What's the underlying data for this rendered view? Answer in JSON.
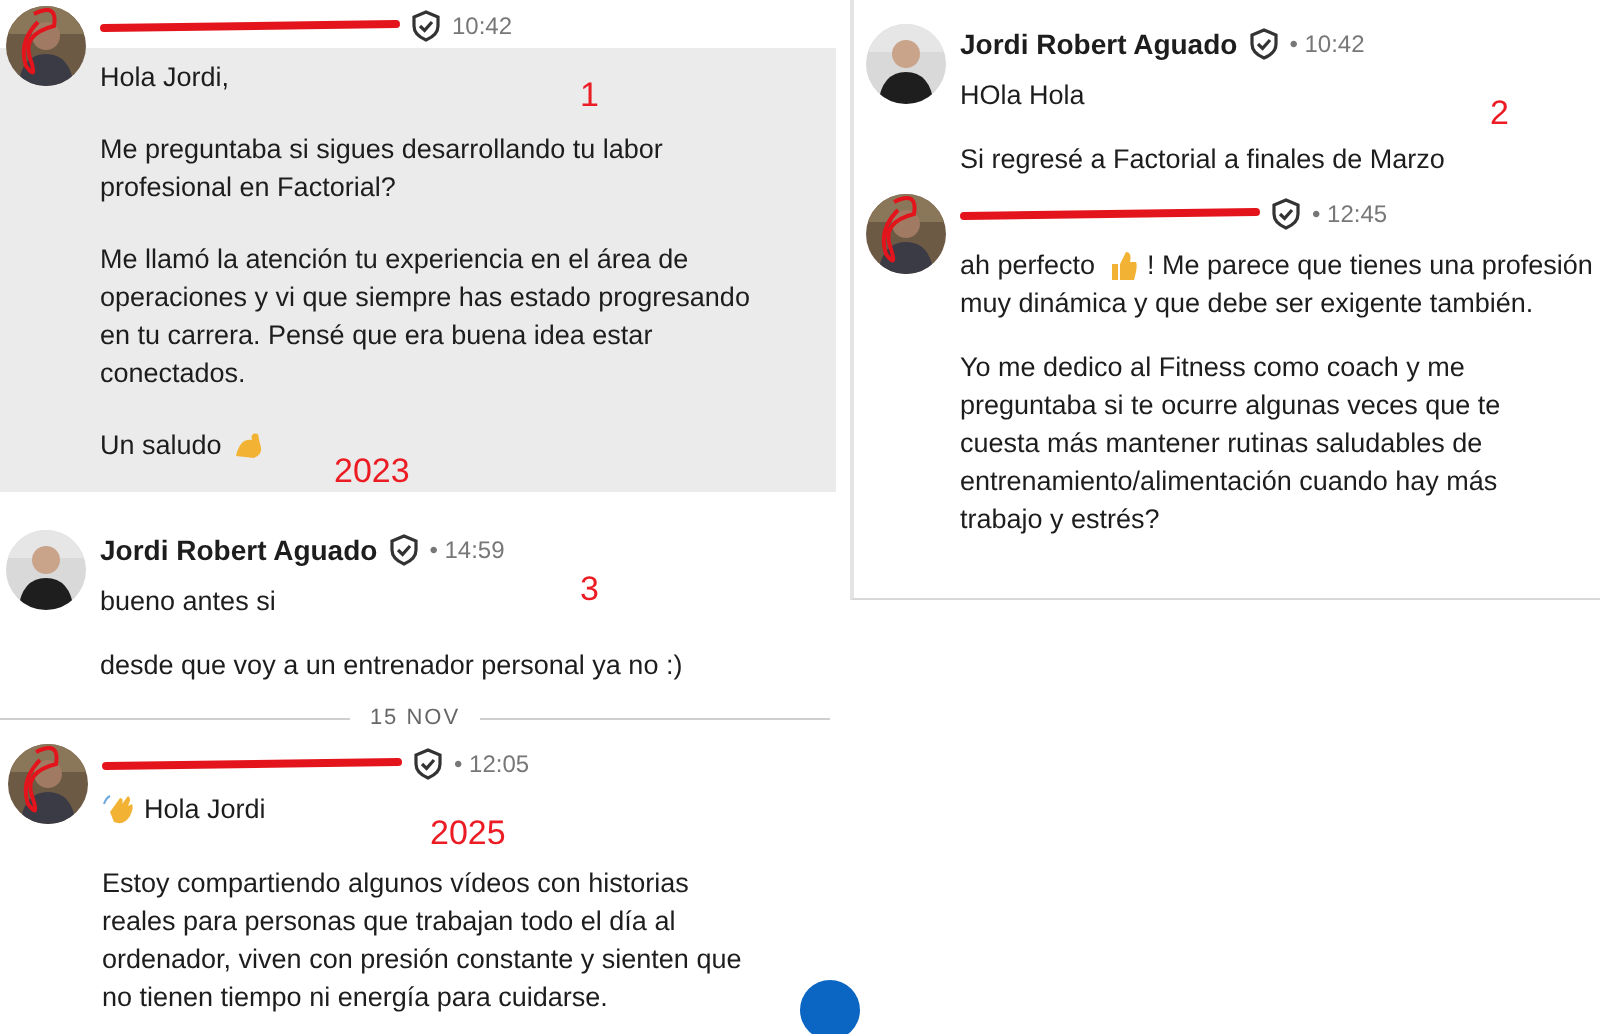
{
  "panels": [
    {
      "annotation": "1",
      "year_note": "2023",
      "highlighted": true,
      "messages": [
        {
          "redacted": true,
          "time": "10:42",
          "paragraphs": [
            [
              [
                {
                  "kind": "text",
                  "text": "Hola Jordi,"
                }
              ]
            ],
            [
              [
                {
                  "kind": "text",
                  "text": "Me preguntaba si sigues desarrollando tu labor profesional en Factorial?"
                }
              ]
            ],
            [
              [
                {
                  "kind": "text",
                  "text": "Me llamó la atención tu experiencia en el área de operaciones y vi que siempre has estado progresando en tu carrera. Pensé que era buena idea estar conectados."
                }
              ]
            ],
            [
              [
                {
                  "kind": "text",
                  "text": "Un saludo"
                },
                {
                  "kind": "flex"
                }
              ]
            ]
          ]
        }
      ]
    },
    {
      "annotation": "2",
      "highlighted": false,
      "messages": [
        {
          "redacted": false,
          "sender": "Jordi Robert Aguado",
          "time": "• 10:42",
          "paragraphs": [
            [
              [
                {
                  "kind": "text",
                  "text": "HOla Hola"
                }
              ]
            ],
            [
              [
                {
                  "kind": "text",
                  "text": "Si regresé a Factorial a finales de Marzo"
                }
              ]
            ]
          ]
        },
        {
          "redacted": true,
          "time": "• 12:45",
          "paragraphs": [
            [
              [
                {
                  "kind": "text",
                  "text": "ah perfecto"
                },
                {
                  "kind": "thumb"
                },
                {
                  "kind": "text",
                  "text": "! Me parece que tienes una profesión"
                }
              ],
              [
                {
                  "kind": "text",
                  "text": "muy dinámica y que debe ser exigente también."
                }
              ]
            ],
            [
              [
                {
                  "kind": "text",
                  "text": "Yo me dedico al Fitness como coach y me preguntaba si te ocurre algunas veces que te cuesta más mantener rutinas saludables de entrenamiento/alimentación cuando hay más trabajo y estrés?"
                }
              ]
            ]
          ]
        }
      ]
    },
    {
      "annotation": "3",
      "highlighted": false,
      "messages": [
        {
          "redacted": false,
          "sender": "Jordi Robert Aguado",
          "time": "• 14:59",
          "paragraphs": [
            [
              [
                {
                  "kind": "text",
                  "text": "bueno antes si"
                }
              ]
            ],
            [
              [
                {
                  "kind": "text",
                  "text": "desde que voy a un entrenador personal ya no :)"
                }
              ]
            ]
          ]
        }
      ]
    },
    {
      "date": "15 NOV",
      "year_note": "2025",
      "highlighted": false,
      "messages": [
        {
          "redacted": true,
          "time": "• 12:05",
          "paragraphs": [
            [
              [
                {
                  "kind": "wave"
                },
                {
                  "kind": "text",
                  "text": "Hola Jordi"
                }
              ]
            ],
            [
              [
                {
                  "kind": "text",
                  "text": "Estoy compartiendo algunos vídeos con historias reales para personas que trabajan todo el día al ordenador, viven con presión constante y sienten que no tienen tiempo ni energía para cuidarse."
                }
              ]
            ]
          ]
        }
      ]
    }
  ]
}
